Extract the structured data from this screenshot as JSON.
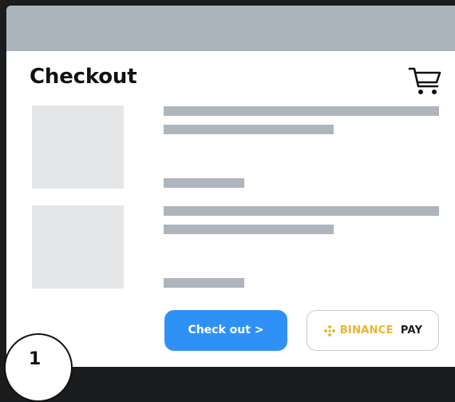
{
  "header": {
    "title": "Checkout"
  },
  "icons": {
    "cart": "cart-icon",
    "binance_logo": "binance-logo-icon"
  },
  "products": [
    {
      "placeholder": true
    },
    {
      "placeholder": true
    }
  ],
  "actions": {
    "checkout_label": "Check out >",
    "binance_brand": "BINANCE",
    "binance_pay": "PAY"
  },
  "step": {
    "number": "1"
  },
  "colors": {
    "topbar": "#adb5bc",
    "checkout_button": "#2f91f6",
    "binance_yellow": "#e8b52a",
    "placeholder_bar": "#aeb5bd",
    "placeholder_thumb": "#e4e6e8",
    "background": "#1b1c1e"
  }
}
